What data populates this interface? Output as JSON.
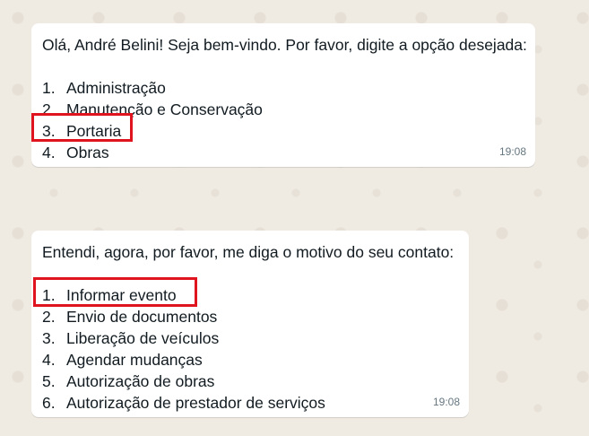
{
  "messages": [
    {
      "text": "Olá, André Belini! Seja bem-vindo. Por favor, digite a opção desejada:",
      "options": [
        {
          "num": "1.",
          "label": "Administração"
        },
        {
          "num": "2.",
          "label": "Manutenção e Conservação"
        },
        {
          "num": "3.",
          "label": "Portaria"
        },
        {
          "num": "4.",
          "label": "Obras"
        }
      ],
      "time": "19:08"
    },
    {
      "text": "Entendi, agora, por favor, me diga o motivo do seu contato:",
      "options": [
        {
          "num": "1.",
          "label": "Informar evento"
        },
        {
          "num": "2.",
          "label": "Envio de documentos"
        },
        {
          "num": "3.",
          "label": "Liberação de veículos"
        },
        {
          "num": "4.",
          "label": "Agendar mudanças"
        },
        {
          "num": "5.",
          "label": "Autorização de obras"
        },
        {
          "num": "6.",
          "label": "Autorização de prestador de serviços"
        }
      ],
      "time": "19:08"
    }
  ],
  "colors": {
    "background": "#efeae2",
    "bubble": "#ffffff",
    "highlight": "#e0141e",
    "timestamp": "#667781"
  }
}
